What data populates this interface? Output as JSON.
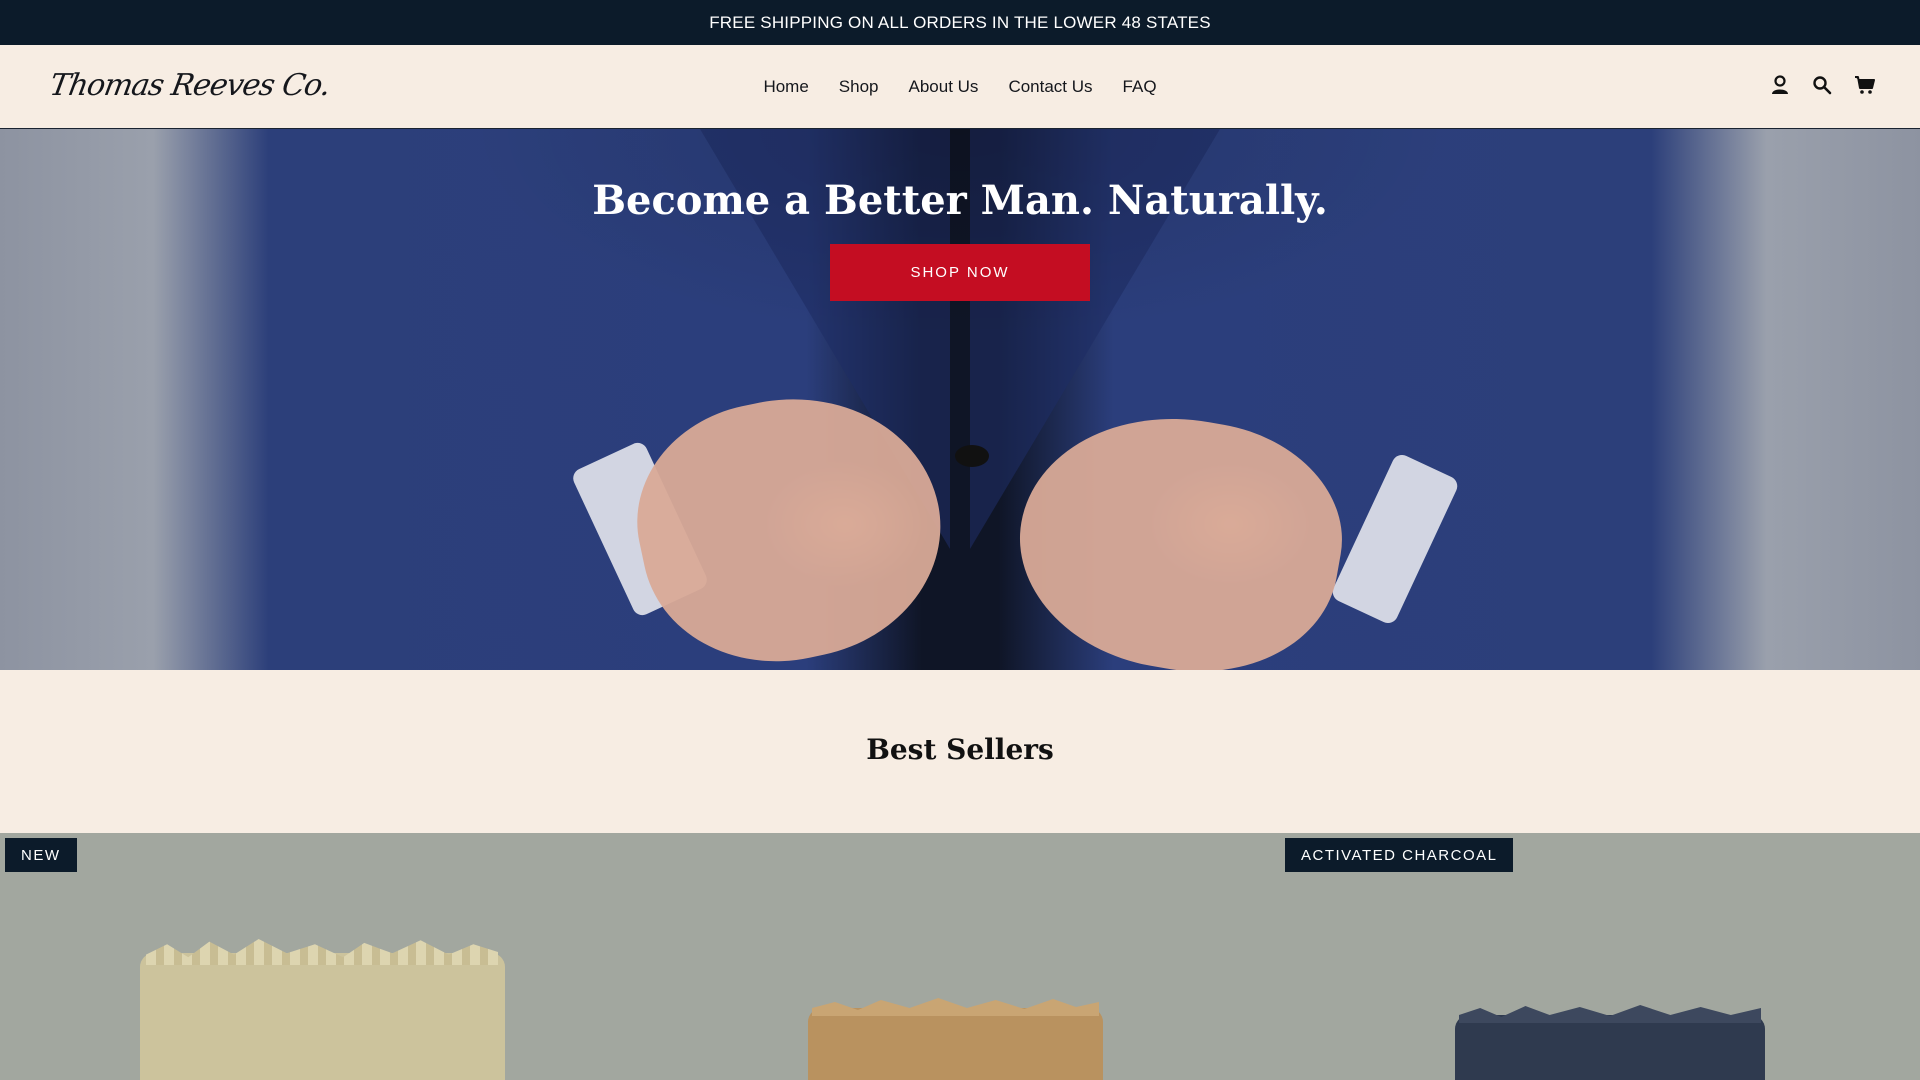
{
  "announcement": "FREE SHIPPING ON ALL ORDERS IN THE LOWER 48 STATES",
  "brand": {
    "logo_text": "Thomas Reeves Co."
  },
  "nav": [
    {
      "label": "Home"
    },
    {
      "label": "Shop"
    },
    {
      "label": "About Us"
    },
    {
      "label": "Contact Us"
    },
    {
      "label": "FAQ"
    }
  ],
  "header_icons": [
    "account-icon",
    "search-icon",
    "cart-icon"
  ],
  "hero": {
    "title": "Become a Better Man. Naturally.",
    "button_label": "SHOP NOW"
  },
  "best_sellers": {
    "title": "Best Sellers",
    "badges": [
      "NEW",
      "ACTIVATED CHARCOAL"
    ]
  },
  "colors": {
    "announcement_bg": "#0c1b2a",
    "page_bg": "#f7ede3",
    "cta_red": "#c40d22",
    "product_bg": "#a2a79f"
  }
}
